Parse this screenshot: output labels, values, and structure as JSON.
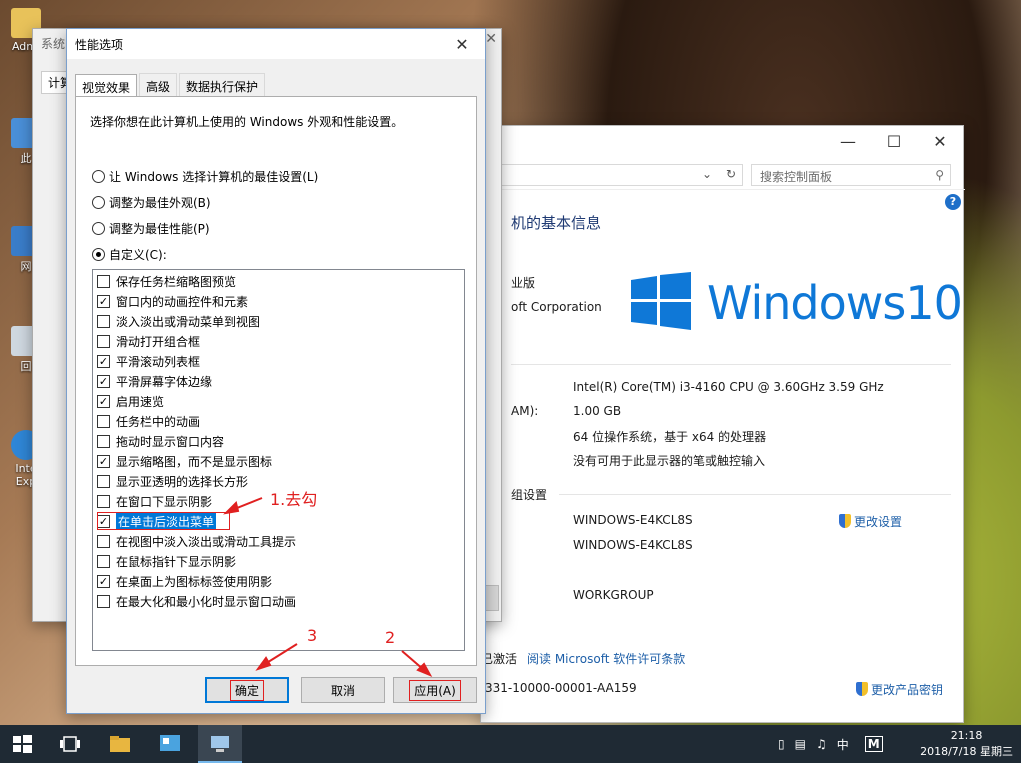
{
  "desktop": {
    "icons": [
      {
        "label": "Admi"
      },
      {
        "label": "此"
      },
      {
        "label": "网"
      },
      {
        "label": "回"
      },
      {
        "label": "Inte Exp"
      }
    ]
  },
  "system_props_window": {
    "title": "系统",
    "tab": "计算"
  },
  "system_window": {
    "search_placeholder": "搜索控制面板",
    "heading": "机的基本信息",
    "edition": "业版",
    "copyright": "oft Corporation",
    "windows_logo_text": "Windows10",
    "processor": "Intel(R) Core(TM) i3-4160 CPU @ 3.60GHz   3.59 GHz",
    "ram_label": "AM):",
    "ram": "1.00 GB",
    "system_type": "64 位操作系统，基于 x64 的处理器",
    "pen_touch": "没有可用于此显示器的笔或触控输入",
    "section_workgroup": "组设置",
    "computer_name": "WINDOWS-E4KCL8S",
    "full_name": "WINDOWS-E4KCL8S",
    "workgroup": "WORKGROUP",
    "change_settings": "更改设置",
    "activation": "已激活",
    "license_link": "阅读 Microsoft 软件许可条款",
    "product_id": "331-10000-00001-AA159",
    "change_key": "更改产品密钥"
  },
  "perf_dialog": {
    "title": "性能选项",
    "tabs": [
      "视觉效果",
      "高级",
      "数据执行保护"
    ],
    "description": "选择你想在此计算机上使用的 Windows 外观和性能设置。",
    "radios": [
      {
        "label": "让 Windows 选择计算机的最佳设置(L)",
        "selected": false
      },
      {
        "label": "调整为最佳外观(B)",
        "selected": false
      },
      {
        "label": "调整为最佳性能(P)",
        "selected": false
      },
      {
        "label": "自定义(C):",
        "selected": true
      }
    ],
    "effects": [
      {
        "label": "保存任务栏缩略图预览",
        "checked": false
      },
      {
        "label": "窗口内的动画控件和元素",
        "checked": true
      },
      {
        "label": "淡入淡出或滑动菜单到视图",
        "checked": false
      },
      {
        "label": "滑动打开组合框",
        "checked": false
      },
      {
        "label": "平滑滚动列表框",
        "checked": true
      },
      {
        "label": "平滑屏幕字体边缘",
        "checked": true
      },
      {
        "label": "启用速览",
        "checked": true
      },
      {
        "label": "任务栏中的动画",
        "checked": false
      },
      {
        "label": "拖动时显示窗口内容",
        "checked": false
      },
      {
        "label": "显示缩略图，而不是显示图标",
        "checked": true
      },
      {
        "label": "显示亚透明的选择长方形",
        "checked": false
      },
      {
        "label": "在窗口下显示阴影",
        "checked": false
      },
      {
        "label": "在单击后淡出菜单",
        "checked": true
      },
      {
        "label": "在视图中淡入淡出或滑动工具提示",
        "checked": false
      },
      {
        "label": "在鼠标指针下显示阴影",
        "checked": false
      },
      {
        "label": "在桌面上为图标标签使用阴影",
        "checked": true
      },
      {
        "label": "在最大化和最小化时显示窗口动画",
        "checked": false
      }
    ],
    "selected_index": 12,
    "ok_label": "确定",
    "cancel_label": "取消",
    "apply_label": "应用(A)"
  },
  "annotations": {
    "step1": "1.去勾",
    "step2": "2",
    "step3": "3",
    "color": "#e02020"
  },
  "taskbar": {
    "ime": "中",
    "ime2": "M",
    "time": "21:18",
    "date": "2018/7/18 星期三"
  },
  "colors": {
    "accent": "#0078d7",
    "win10_blue": "#0f78d7",
    "taskbar": "#1f2a34"
  }
}
